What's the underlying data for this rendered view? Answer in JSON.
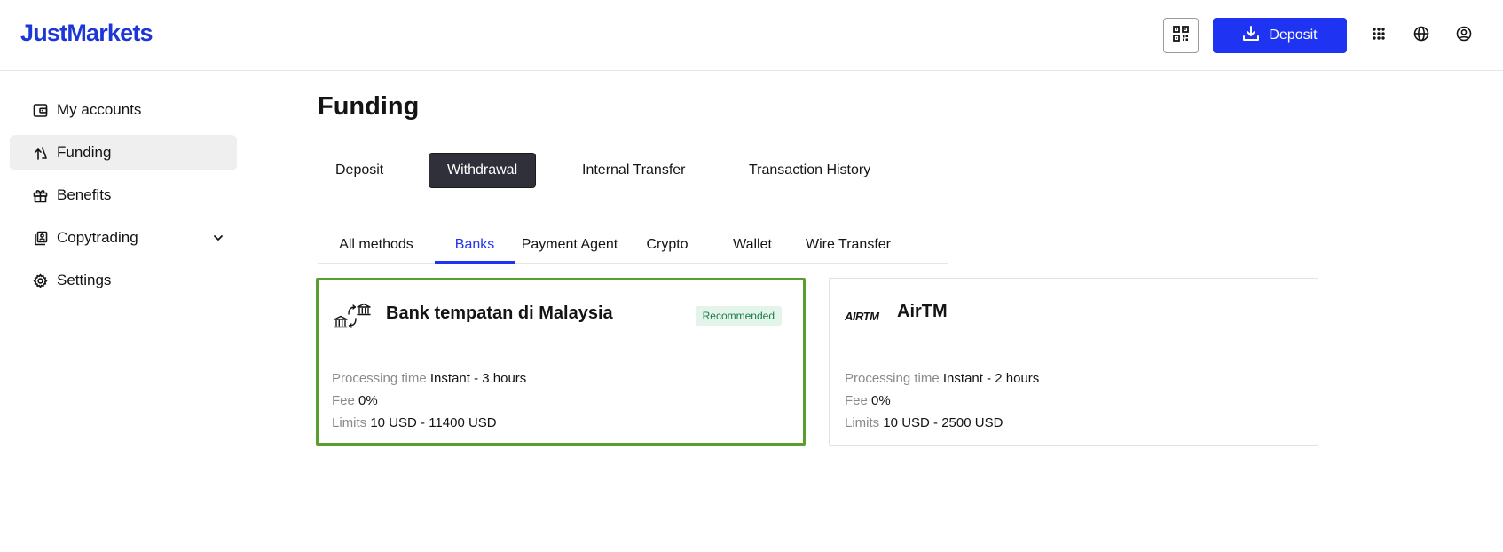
{
  "brand": {
    "logo": "JustMarkets",
    "accent": "#1f33f2"
  },
  "header": {
    "qr_icon": "qr-code-icon",
    "deposit_label": "Deposit",
    "apps_icon": "apps-grid-icon",
    "language_icon": "globe-icon",
    "profile_icon": "user-circle-icon"
  },
  "sidebar": {
    "items": [
      {
        "label": "My accounts",
        "icon": "wallet-icon",
        "active": false
      },
      {
        "label": "Funding",
        "icon": "transfer-arrows-icon",
        "active": true
      },
      {
        "label": "Benefits",
        "icon": "gift-icon",
        "active": false
      },
      {
        "label": "Copytrading",
        "icon": "copytrading-icon",
        "active": false,
        "expandable": true
      },
      {
        "label": "Settings",
        "icon": "gear-icon",
        "active": false
      }
    ]
  },
  "main": {
    "title": "Funding",
    "tabs": [
      {
        "label": "Deposit",
        "active": false
      },
      {
        "label": "Withdrawal",
        "active": true
      },
      {
        "label": "Internal Transfer",
        "active": false
      },
      {
        "label": "Transaction History",
        "active": false
      }
    ],
    "subtabs": [
      {
        "label": "All methods",
        "active": false
      },
      {
        "label": "Banks",
        "active": true
      },
      {
        "label": "Payment Agent",
        "active": false
      },
      {
        "label": "Crypto",
        "active": false
      },
      {
        "label": "Wallet",
        "active": false
      },
      {
        "label": "Wire Transfer",
        "active": false
      }
    ],
    "methods": [
      {
        "title": "Bank tempatan di Malaysia",
        "badge": "Recommended",
        "selected": true,
        "processing_label": "Processing time",
        "processing_value": "Instant - 3 hours",
        "fee_label": "Fee",
        "fee_value": "0%",
        "limits_label": "Limits",
        "limits_value": "10 USD - 11400 USD"
      },
      {
        "title": "AirTM",
        "logo_text": "AIRTM",
        "selected": false,
        "processing_label": "Processing time",
        "processing_value": "Instant - 2 hours",
        "fee_label": "Fee",
        "fee_value": "0%",
        "limits_label": "Limits",
        "limits_value": "10 USD - 2500 USD"
      }
    ]
  }
}
